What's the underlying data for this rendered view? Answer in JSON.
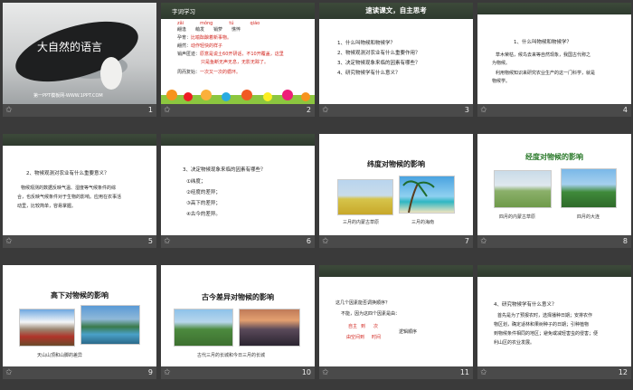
{
  "slides": [
    {
      "num": "1",
      "title": "大自然的语言",
      "subtitle": "第一PPT模板网-WWW.1PPT.COM"
    },
    {
      "num": "2",
      "header": "字词学习",
      "pinyin": [
        "zǎi",
        "mǒng",
        "tú",
        "qiáo"
      ],
      "chars": [
        "翩逢",
        "萌发",
        "销萝",
        "憔悴"
      ],
      "lines": [
        {
          "k": "孕育：",
          "v": "比喻酝酿着新事物。"
        },
        {
          "k": "翩然：",
          "v": "动作轻快的样子"
        },
        {
          "k": "销声匿迹：",
          "v": "原意是说土60开研话，不10开覆盖，这里"
        },
        {
          "k": "",
          "v": "只是鱼断无声无息，无影无踪了。"
        },
        {
          "k": "周而复始：",
          "v": "一次又一次的循环。"
        }
      ]
    },
    {
      "num": "3",
      "header": "速读课文，自主思考",
      "items": [
        "1、什么叫物候和物候学？",
        "2、物候观测对农业有什么重要作用？",
        "3、决定物候现象来临的因素有哪些？",
        "4、研究物候学有什么意义？"
      ]
    },
    {
      "num": "4",
      "q": "1、什么叫物候和物候学？",
      "a1": "草木荣枯，候鸟去来等自然现象，我国古代称之",
      "a2": "为物候。",
      "a3": "利用物候知识来研究农业生产的这一门科学，就是",
      "a4": "物候学。"
    },
    {
      "num": "5",
      "q": "2、物候观测对农业有什么重要意义？",
      "a": [
        "物候观测的数据反映气温、湿度等气候条件的综",
        "合，也反映气候条件对于生物的影响。应用在农事活",
        "动里，比较简单，容易掌握。"
      ]
    },
    {
      "num": "6",
      "q": "3、决定物候现象来临的因素有哪些？",
      "items": [
        "①纬度；",
        "②经度的差异；",
        "③高下的差异；",
        "④古今的差异。"
      ]
    },
    {
      "num": "7",
      "title": "纬度对物候的影响",
      "cap1": "三月的内蒙古草原",
      "cap2": "三月的海南"
    },
    {
      "num": "8",
      "title": "经度对物候的影响",
      "cap1": "四月的内蒙古草原",
      "cap2": "四月的大连"
    },
    {
      "num": "9",
      "title": "高下对物候的影响",
      "cap": "天山山顶和山脚的差异"
    },
    {
      "num": "10",
      "title": "古今差异对物候的影响",
      "cap": "古代三月的长城和今日三月的长城"
    },
    {
      "num": "11",
      "q1": "这几个因素能否调换顺序？",
      "q2": "不能，因为这四个因素是由：",
      "w1": "自主",
      "w2": "到",
      "w3": "次",
      "w4": "由空间到",
      "w5": "时间",
      "w6": "逻辑顺序"
    },
    {
      "num": "12",
      "q": "4、研究物候学有什么意义？",
      "a": [
        "首先是为了预报农时，选择播种日期；安排农作",
        "物区划，确定适林和果树种子的日期；引种植物",
        "到物候条件相同的地区；避免或减轻害虫的侵害；便",
        "利山区的农业发展。"
      ]
    }
  ],
  "colors": {
    "accent_red": "#d2261f",
    "footer": "#4a4a4a",
    "bg": "#3a3a3a"
  }
}
